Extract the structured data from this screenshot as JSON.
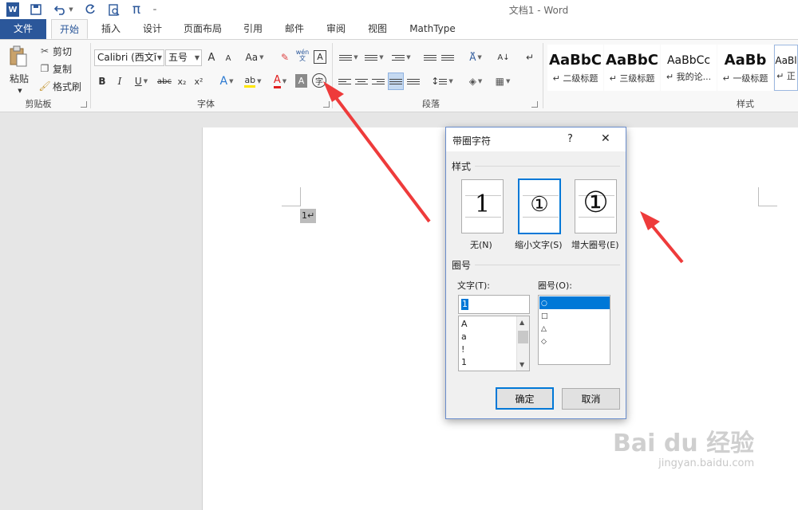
{
  "window": {
    "title": "文档1 - Word"
  },
  "quick_access": {
    "icons": [
      "word-logo-icon",
      "save-icon",
      "undo-icon",
      "redo-icon",
      "print-preview-icon",
      "equation-icon",
      "customize-icon"
    ],
    "equation_glyph": "π"
  },
  "tabs": [
    "文件",
    "开始",
    "插入",
    "设计",
    "页面布局",
    "引用",
    "邮件",
    "审阅",
    "视图",
    "MathType"
  ],
  "active_tab": "开始",
  "ribbon": {
    "clipboard": {
      "paste": "粘贴",
      "cut": "剪切",
      "copy": "复制",
      "format_painter": "格式刷",
      "group": "剪贴板"
    },
    "font": {
      "font_name": "Calibri (西文ĭ",
      "font_size": "五号",
      "grow": "A",
      "shrink": "A",
      "change_case": "Aa",
      "phonetic": "wén\n文",
      "border_char": "A",
      "bold": "B",
      "italic": "I",
      "underline": "U",
      "strike": "abc",
      "subscript": "x₂",
      "superscript": "x²",
      "text_effect": "A",
      "highlight": "ab",
      "font_color": "A",
      "shading": "A",
      "enclose": "字",
      "group": "字体"
    },
    "paragraph": {
      "group": "段落"
    },
    "styles": {
      "group": "样式",
      "items": [
        {
          "sample": "AaBbC",
          "name": "↵ 二级标题"
        },
        {
          "sample": "AaBbC",
          "name": "↵ 三级标题"
        },
        {
          "sample": "AaBbCc",
          "name": "↵ 我的论..."
        },
        {
          "sample": "AaBb",
          "name": "↵ 一级标题"
        },
        {
          "sample": "AaBl",
          "name": "↵ 正"
        }
      ]
    }
  },
  "document": {
    "char": "1↵"
  },
  "dialog": {
    "title": "带圈字符",
    "help": "?",
    "close": "✕",
    "style_section": "样式",
    "options": [
      {
        "glyph": "1",
        "label": "无(N)"
      },
      {
        "glyph": "①",
        "label": "缩小文字(S)"
      },
      {
        "glyph": "①",
        "label": "增大圈号(E)"
      }
    ],
    "enclosure_section": "圈号",
    "text_label": "文字(T):",
    "text_value": "1",
    "text_list": [
      "A",
      "a",
      "!",
      "1"
    ],
    "enclosure_label": "圈号(O):",
    "enclosure_list": [
      "○",
      "□",
      "△",
      "◇"
    ],
    "ok": "确定",
    "cancel": "取消"
  },
  "watermark": {
    "brand": "Bai du 经验",
    "url": "jingyan.baidu.com"
  },
  "colors": {
    "accent": "#2b579a",
    "selection": "#0078d7",
    "arrow": "#ee3b3b"
  }
}
